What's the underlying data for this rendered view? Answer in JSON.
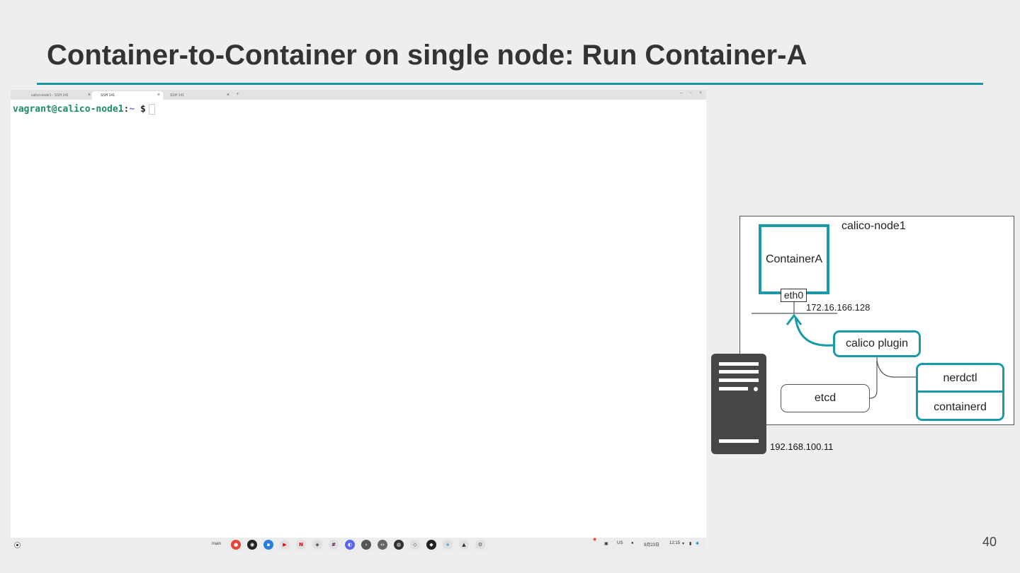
{
  "slide": {
    "title": "Container-to-Container on single node: Run Container-A",
    "page_number": "40"
  },
  "terminal": {
    "tabs": [
      {
        "label": "calico-node1 - SSH 141",
        "active": false
      },
      {
        "label": "SSH 141",
        "active": true
      },
      {
        "label": "SSH 141",
        "active": false
      }
    ],
    "prompt": {
      "user_host": "vagrant@calico-node1",
      "separator": ":",
      "path": "~",
      "symbol": "$"
    }
  },
  "shelf": {
    "desk_label": "main",
    "apps": [
      "chrome-icon",
      "github-icon",
      "files-icon",
      "youtube-icon",
      "netflix-icon",
      "password-icon",
      "slack-icon",
      "discord-icon",
      "terminal-icon",
      "code-icon",
      "app-icon",
      "app-icon",
      "app-icon",
      "add-icon",
      "app-icon",
      "settings-icon"
    ],
    "tray": {
      "keyboard": "US",
      "date": "9月23日",
      "time": "12:15"
    }
  },
  "diagram": {
    "node_label": "calico-node1",
    "container_label": "ContainerA",
    "interface_label": "eth0",
    "container_ip": "172.16.166.128",
    "plugin_label": "calico plugin",
    "etcd_label": "etcd",
    "nerdctl_label": "nerdctl",
    "containerd_label": "containerd",
    "host_ip": "192.168.100.11",
    "accent_color": "#1a9aa8"
  }
}
